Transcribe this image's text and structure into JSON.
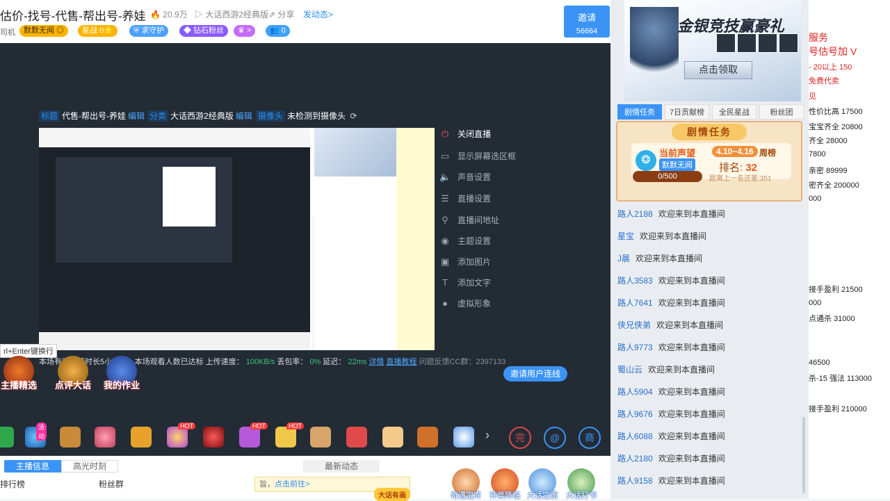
{
  "header": {
    "room_title": "估价-找号-代售-帮出号-养娃",
    "heat": "20.9万",
    "category": "大话西游2经典版",
    "share": "分享",
    "post": "发动态>",
    "role": "司机",
    "badges": {
      "name": "默默无闻",
      "star": "星战",
      "star_count": "0",
      "guard": "求守护",
      "fan": "钻石粉丝",
      "level": ">",
      "count": "0"
    },
    "invite": {
      "label": "邀请",
      "count": "56664"
    }
  },
  "stage": {
    "info": {
      "title_label": "标题",
      "title_value": "代售-帮出号-养娃",
      "edit": "编辑",
      "category_label": "分类",
      "category_value": "大话西游2经典版",
      "camera_label": "摄像头",
      "camera_value": "未检测到摄像头"
    },
    "menu": [
      {
        "icon": "power-icon",
        "glyph": "⏻",
        "label": "关闭直播"
      },
      {
        "icon": "screen-icon",
        "glyph": "▭",
        "label": "显示屏幕选区框"
      },
      {
        "icon": "speaker-icon",
        "glyph": "🔈",
        "label": "声音设置"
      },
      {
        "icon": "sliders-icon",
        "glyph": "☰",
        "label": "直播设置"
      },
      {
        "icon": "location-icon",
        "glyph": "⚲",
        "label": "直播间地址"
      },
      {
        "icon": "palette-icon",
        "glyph": "◉",
        "label": "主题设置"
      },
      {
        "icon": "image-icon",
        "glyph": "▣",
        "label": "添加图片"
      },
      {
        "icon": "text-icon",
        "glyph": "T",
        "label": "添加文字"
      },
      {
        "icon": "avatar-icon",
        "glyph": "●",
        "label": "虚拟形象"
      }
    ],
    "tooltip": "rl+Enter键换行",
    "status": {
      "duration": "本场有效开播时长5小时3",
      "viewers": "本场观看人数已达标",
      "upload_label": "上传速度：",
      "upload_value": "100KB/s",
      "loss_label": "丢包率：",
      "loss_value": "0%",
      "latency_label": "延迟：",
      "latency_value": "22ms",
      "detail": "详情",
      "tutorial": "直播教程",
      "feedback": "问题反馈CC群：2397133"
    },
    "connect": "邀请用户连线",
    "tasks": [
      "主播精选",
      "点评大话",
      "我的作业"
    ]
  },
  "gifts": {
    "hot": "HOT",
    "activity": "活动",
    "round1": "完",
    "round3": "商"
  },
  "bottom": {
    "tab_host": "主播信息",
    "tab_highlight": "高光时刻",
    "tab_news": "最新动态",
    "rank": "排行榜",
    "fans": "粉丝群",
    "tip_prefix": "旨，",
    "tip_link": "点击前往>",
    "tip_tag": "大话有画",
    "shortcuts": [
      "奇遇宝库",
      "神兽降临",
      "大话宝图",
      "大话打书"
    ]
  },
  "sidebar": {
    "ad": {
      "title": "金银竞技赢豪礼",
      "button": "点击领取"
    },
    "tabs": [
      "剧情任务",
      "7日贡献榜",
      "全民星战",
      "粉丝团"
    ],
    "plot": {
      "title": "剧情任务",
      "prestige": "当前声望",
      "user": "默默无闻",
      "week": "4.10~4.16",
      "weekly": "周榜",
      "rank_label": "排名:",
      "rank_value": "32",
      "progress": "0/500",
      "progress_fraction": 0.0,
      "diff": "距离上一名还差:351"
    },
    "chat": [
      {
        "nick": "路人2188",
        "msg": "欢迎来到本直播间"
      },
      {
        "nick": "星宝",
        "msg": "欢迎来到本直播间"
      },
      {
        "nick": "J晨",
        "msg": "欢迎来到本直播间"
      },
      {
        "nick": "路人3583",
        "msg": "欢迎来到本直播间"
      },
      {
        "nick": "路人7641",
        "msg": "欢迎来到本直播间"
      },
      {
        "nick": "侠兄侠弟",
        "msg": "欢迎来到本直播间"
      },
      {
        "nick": "路人9773",
        "msg": "欢迎来到本直播间"
      },
      {
        "nick": "蜀山云",
        "msg": "欢迎来到本直播间"
      },
      {
        "nick": "路人5904",
        "msg": "欢迎来到本直播间"
      },
      {
        "nick": "路人9676",
        "msg": "欢迎来到本直播间"
      },
      {
        "nick": "路人6088",
        "msg": "欢迎来到本直播间"
      },
      {
        "nick": "路人2180",
        "msg": "欢迎来到本直播间"
      },
      {
        "nick": "路人9158",
        "msg": "欢迎来到本直播间"
      }
    ]
  },
  "notes": [
    {
      "text": "服务",
      "style": "red big"
    },
    {
      "text": "号估号加 V",
      "style": "red big"
    },
    {
      "text": "- 20以上 150",
      "style": "red"
    },
    {
      "text": "免费代卖",
      "style": "red"
    },
    {
      "text": "见",
      "style": "red"
    },
    {
      "text": "性价比高 17500",
      "style": ""
    },
    {
      "text": "宝宝齐全 20800",
      "style": ""
    },
    {
      "text": "齐全 28000",
      "style": ""
    },
    {
      "text": "7800",
      "style": ""
    },
    {
      "text": "亲密 89999",
      "style": ""
    },
    {
      "text": "密齐全 200000",
      "style": ""
    },
    {
      "text": "000",
      "style": ""
    },
    {
      "text": "接手盈利 21500",
      "style": ""
    },
    {
      "text": "000",
      "style": ""
    },
    {
      "text": "点通杀 31000",
      "style": ""
    },
    {
      "text": "46500",
      "style": ""
    },
    {
      "text": "杀-15 强法 113000",
      "style": ""
    },
    {
      "text": "接手盈利 210000",
      "style": ""
    }
  ]
}
